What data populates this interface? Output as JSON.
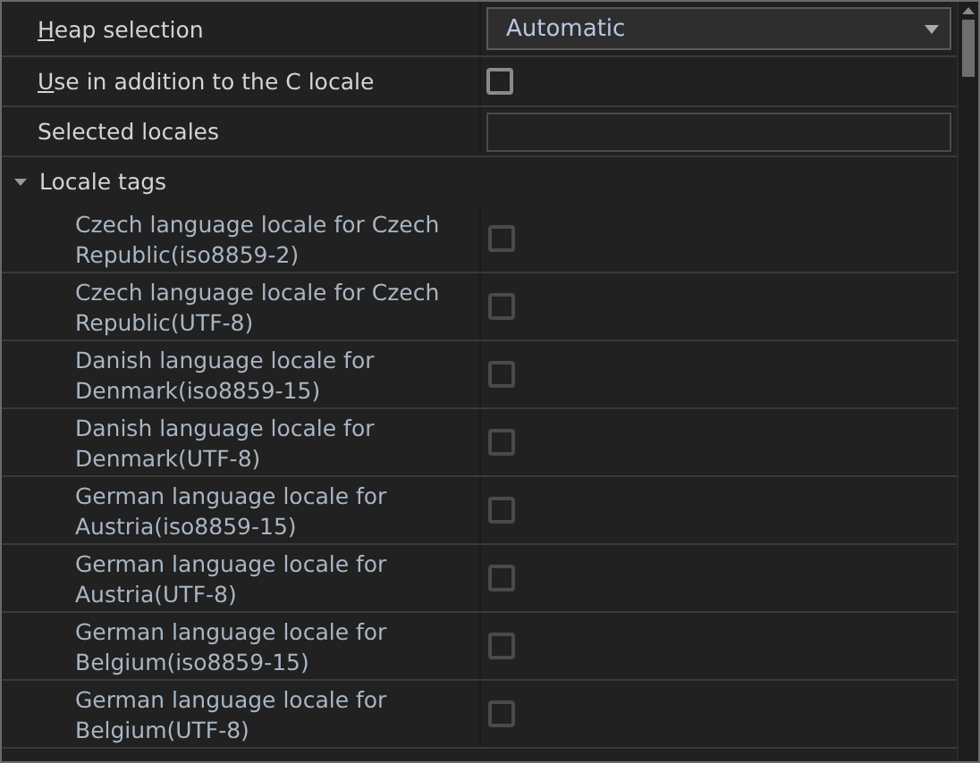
{
  "properties": [
    {
      "kind": "dropdown",
      "label": "Heap selection",
      "mnemonic": true,
      "value": "Automatic"
    },
    {
      "kind": "checkbox",
      "label": "Use in addition to the C locale",
      "mnemonic": true,
      "checked": false,
      "disabled": false
    },
    {
      "kind": "text",
      "label": "Selected locales",
      "mnemonic": false
    }
  ],
  "locale_tags": {
    "label": "Locale tags",
    "expanded": true,
    "items": [
      {
        "label": "Czech language locale for Czech Republic(iso8859-2)",
        "checked": false,
        "disabled": true
      },
      {
        "label": "Czech language locale for Czech Republic(UTF-8)",
        "checked": false,
        "disabled": true
      },
      {
        "label": "Danish language locale for Denmark(iso8859-15)",
        "checked": false,
        "disabled": true
      },
      {
        "label": "Danish language locale for Denmark(UTF-8)",
        "checked": false,
        "disabled": true
      },
      {
        "label": "German language locale for Austria(iso8859-15)",
        "checked": false,
        "disabled": true
      },
      {
        "label": "German language locale for Austria(UTF-8)",
        "checked": false,
        "disabled": true
      },
      {
        "label": "German language locale for Belgium(iso8859-15)",
        "checked": false,
        "disabled": true
      },
      {
        "label": "German language locale for Belgium(UTF-8)",
        "checked": false,
        "disabled": true
      }
    ]
  }
}
